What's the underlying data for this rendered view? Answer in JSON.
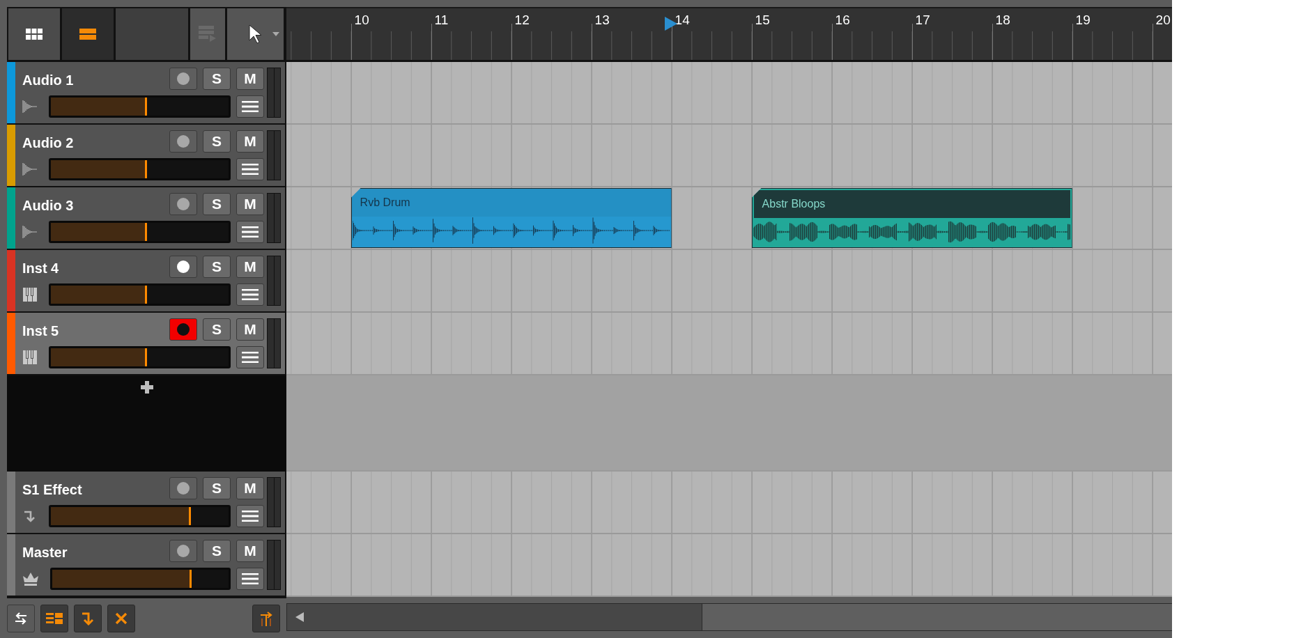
{
  "view_buttons": [
    {
      "kind": "grid",
      "selected": false
    },
    {
      "kind": "arrange",
      "selected": true
    }
  ],
  "tool_buttons": [
    {
      "kind": "stack",
      "disabled": true
    },
    {
      "kind": "pointer",
      "disabled": false
    }
  ],
  "ruler": {
    "bars": [
      "10",
      "11",
      "12",
      "13",
      "14",
      "15",
      "16",
      "17",
      "18",
      "19",
      "20"
    ]
  },
  "tracks": [
    {
      "name": "Audio 1",
      "kind": "audio",
      "color": "#0d98da",
      "selected": false,
      "record_enabled": false,
      "armed": false,
      "solo_label": "S",
      "mute_label": "M",
      "level": 0.54
    },
    {
      "name": "Audio 2",
      "kind": "audio",
      "color": "#d99c00",
      "selected": false,
      "record_enabled": false,
      "armed": false,
      "solo_label": "S",
      "mute_label": "M",
      "level": 0.54
    },
    {
      "name": "Audio 3",
      "kind": "audio",
      "color": "#00a38d",
      "selected": false,
      "record_enabled": false,
      "armed": false,
      "solo_label": "S",
      "mute_label": "M",
      "level": 0.54,
      "clips": [
        {
          "name": "Rvb Drum",
          "kind": "drums",
          "color": "#2698cf",
          "selected": false
        },
        {
          "name": "Abstr Bloops",
          "kind": "loop",
          "color": "#22a898",
          "selected": true
        }
      ]
    },
    {
      "name": "Inst 4",
      "kind": "instrument",
      "color": "#d83323",
      "selected": false,
      "record_enabled": true,
      "armed": false,
      "solo_label": "S",
      "mute_label": "M",
      "level": 0.54
    },
    {
      "name": "Inst 5",
      "kind": "instrument",
      "color": "#ff5a00",
      "selected": true,
      "record_enabled": true,
      "armed": true,
      "solo_label": "S",
      "mute_label": "M",
      "level": 0.54
    }
  ],
  "fx_tracks": [
    {
      "name": "S1 Effect",
      "kind": "effect",
      "color": "#7a7a7a",
      "selected": false,
      "record_enabled": false,
      "armed": false,
      "solo_label": "S",
      "mute_label": "M",
      "level": 0.79
    },
    {
      "name": "Master",
      "kind": "master",
      "color": "#7a7a7a",
      "selected": false,
      "record_enabled": false,
      "armed": false,
      "solo_label": "S",
      "mute_label": "M",
      "level": 0.79
    }
  ],
  "footer_toggles": [
    {
      "kind": "swap",
      "on": false
    },
    {
      "kind": "layout",
      "on": true
    },
    {
      "kind": "fx",
      "on": true
    },
    {
      "kind": "remove",
      "on": true
    }
  ]
}
